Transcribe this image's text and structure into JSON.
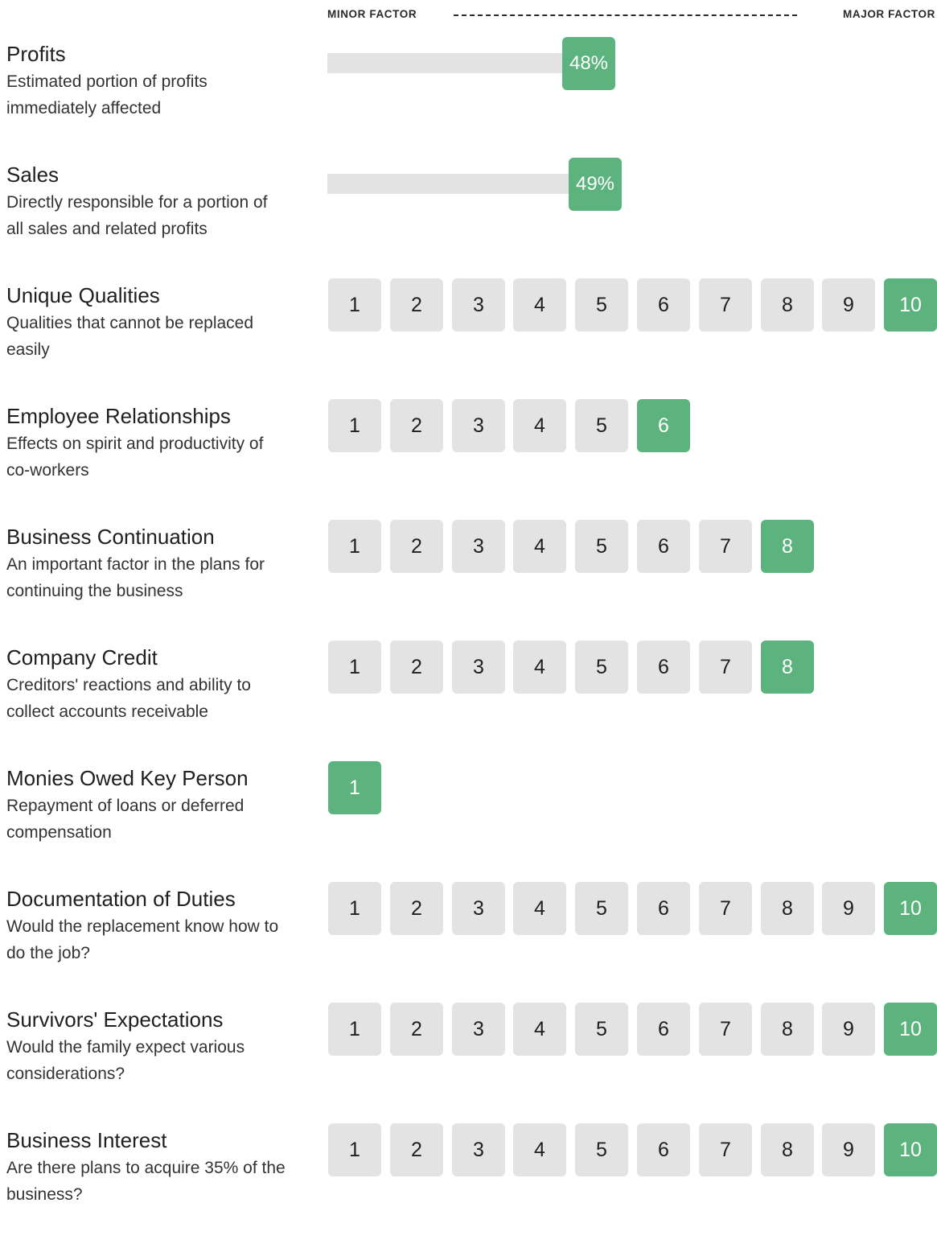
{
  "scale": {
    "min_label": "MINOR FACTOR",
    "max_label": "MAJOR FACTOR"
  },
  "colors": {
    "accent": "#5db37e",
    "inactive": "#e3e3e3",
    "text": "#222222"
  },
  "factors": [
    {
      "title": "Profits",
      "description": "Estimated portion of profits immediately affected",
      "type": "percent",
      "value": 48,
      "value_label": "48%"
    },
    {
      "title": "Sales",
      "description": "Directly responsible for a portion of all sales and related profits",
      "type": "percent",
      "value": 49,
      "value_label": "49%"
    },
    {
      "title": "Unique Qualities",
      "description": "Qualities that cannot be replaced easily",
      "type": "rating",
      "value": 10
    },
    {
      "title": "Employee Relationships",
      "description": "Effects on spirit and productivity of co-workers",
      "type": "rating",
      "value": 6
    },
    {
      "title": "Business Continuation",
      "description": "An important factor in the plans for continuing the business",
      "type": "rating",
      "value": 8
    },
    {
      "title": "Company Credit",
      "description": "Creditors' reactions and ability to collect accounts receivable",
      "type": "rating",
      "value": 8
    },
    {
      "title": "Monies Owed Key Person",
      "description": "Repayment of loans or deferred compensation",
      "type": "rating",
      "value": 1
    },
    {
      "title": "Documentation of Duties",
      "description": "Would the replacement know how to do the job?",
      "type": "rating",
      "value": 10
    },
    {
      "title": "Survivors' Expectations",
      "description": "Would the family expect various considerations?",
      "type": "rating",
      "value": 10
    },
    {
      "title": "Business Interest",
      "description": "Are there plans to acquire 35% of the business?",
      "type": "rating",
      "value": 10
    }
  ]
}
